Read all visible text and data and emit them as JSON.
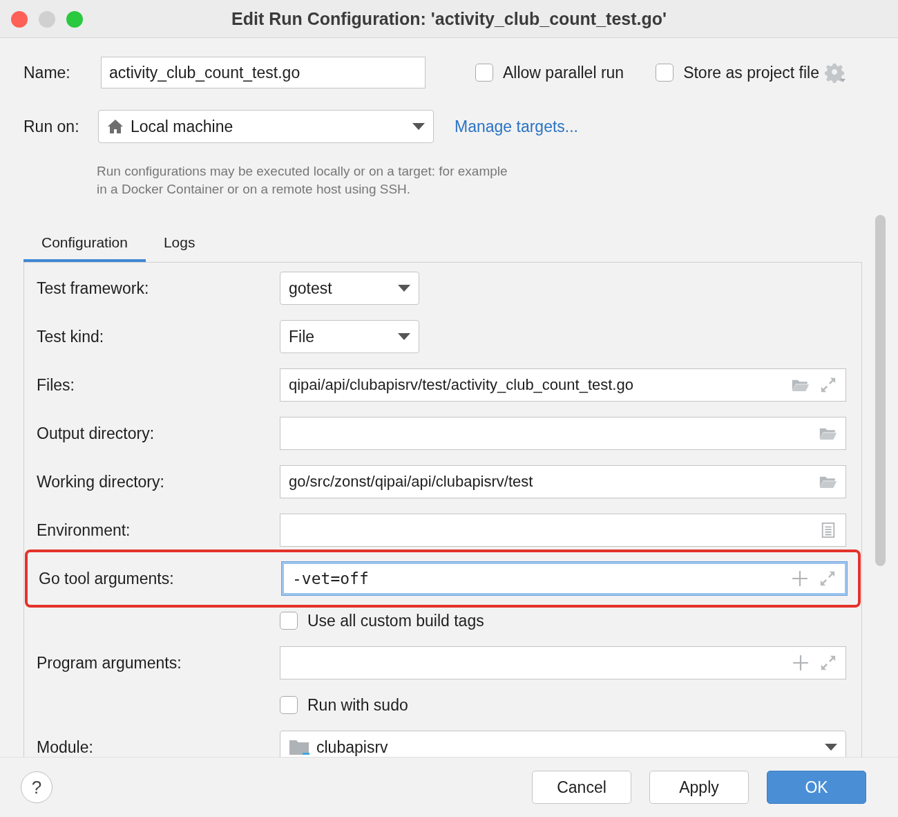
{
  "window": {
    "title": "Edit Run Configuration: 'activity_club_count_test.go'"
  },
  "name": {
    "label": "Name:",
    "value": "activity_club_count_test.go"
  },
  "options": [
    {
      "label": "Allow parallel run",
      "checked": false
    },
    {
      "label": "Store as project file",
      "checked": false
    }
  ],
  "run_on": {
    "label": "Run on:",
    "value": "Local machine",
    "link": "Manage targets..."
  },
  "hint": "Run configurations may be executed locally or on a target: for example\nin a Docker Container or on a remote host using SSH.",
  "tabs": [
    {
      "label": "Configuration",
      "selected": true
    },
    {
      "label": "Logs",
      "selected": false
    }
  ],
  "rows": [
    {
      "kind": "select",
      "label": "Test framework:",
      "value": "gotest"
    },
    {
      "kind": "select",
      "label": "Test kind:",
      "value": "File"
    },
    {
      "kind": "file",
      "label": "Files:",
      "value": "qipai/api/clubapisrv/test/activity_club_count_test.go"
    },
    {
      "kind": "dir",
      "label": "Output directory:"
    },
    {
      "kind": "dir",
      "label": "Working directory:",
      "value": "go/src/zonst/qipai/api/clubapisrv/test"
    },
    {
      "kind": "env",
      "label": "Environment:"
    },
    {
      "kind": "args",
      "label": "Go tool arguments:",
      "value": "-vet=off",
      "focused": true,
      "highlighted": true
    },
    {
      "kind": "checkbox",
      "label": "Use all custom build tags",
      "checked": false
    },
    {
      "kind": "args",
      "label": "Program arguments:",
      "focused": false,
      "highlighted": false
    },
    {
      "kind": "checkbox",
      "label": "Run with sudo",
      "checked": false
    },
    {
      "kind": "module",
      "label": "Module:",
      "value": "clubapisrv"
    }
  ],
  "buttons": [
    {
      "label": "Cancel",
      "primary": false
    },
    {
      "label": "Apply",
      "primary": false
    },
    {
      "label": "OK",
      "primary": true
    }
  ],
  "help": "?"
}
